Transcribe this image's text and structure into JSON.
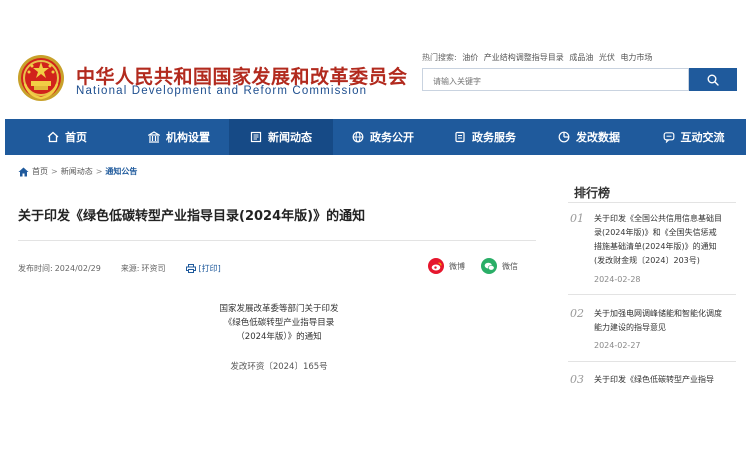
{
  "header": {
    "title_cn": "中华人民共和国国家发展和改革委员会",
    "title_en": "National Development and Reform Commission",
    "hot_label": "热门搜索:",
    "hot_terms": [
      "油价",
      "产业结构调整指导目录",
      "成品油",
      "光伏",
      "电力市场"
    ],
    "search_placeholder": "请输入关键字"
  },
  "nav": {
    "items": [
      {
        "label": "首页",
        "icon": "home-icon"
      },
      {
        "label": "机构设置",
        "icon": "building-icon"
      },
      {
        "label": "新闻动态",
        "icon": "news-icon",
        "active": true
      },
      {
        "label": "政务公开",
        "icon": "globe-icon"
      },
      {
        "label": "政务服务",
        "icon": "service-icon"
      },
      {
        "label": "发改数据",
        "icon": "pie-chart-icon"
      },
      {
        "label": "互动交流",
        "icon": "chat-icon"
      }
    ]
  },
  "breadcrumb": [
    "首页",
    "新闻动态",
    "通知公告"
  ],
  "article": {
    "title": "关于印发《绿色低碳转型产业指导目录(2024年版)》的通知",
    "publish_label": "发布时间:",
    "publish_date": "2024/02/29",
    "source_label": "来源:",
    "source": "环资司",
    "print_label": "[打印]",
    "share_weibo": "微博",
    "share_wechat": "微信",
    "doc_heading": [
      "国家发展改革委等部门关于印发",
      "《绿色低碳转型产业指导目录",
      "（2024年版）》的通知"
    ],
    "doc_number": "发改环资〔2024〕165号"
  },
  "ranking": {
    "title": "排行榜",
    "items": [
      {
        "num": "01",
        "text": "关于印发《全国公共信用信息基础目录(2024年版)》和《全国失信惩戒措施基础清单(2024年版)》的通知(发改财金规〔2024〕203号)",
        "date": "2024-02-28"
      },
      {
        "num": "02",
        "text": "关于加强电网调峰储能和智能化调度能力建设的指导意见",
        "date": "2024-02-27"
      },
      {
        "num": "03",
        "text": "关于印发《绿色低碳转型产业指导",
        "date": ""
      }
    ]
  },
  "colors": {
    "brand_red": "#b22a1e",
    "brand_blue": "#1f5a9c",
    "nav_active": "#164a86"
  }
}
